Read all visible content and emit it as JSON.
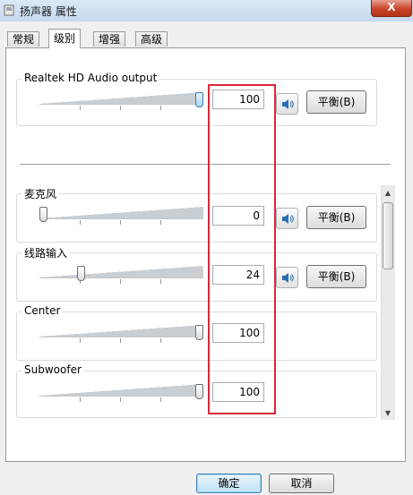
{
  "window": {
    "title": "扬声器 属性",
    "close_glyph": "X"
  },
  "tabs": [
    {
      "label": "常规"
    },
    {
      "label": "级别",
      "active": true
    },
    {
      "label": "增强"
    },
    {
      "label": "高级"
    }
  ],
  "master": {
    "label": "Realtek HD Audio output",
    "value": "100",
    "level_fraction": 1.0,
    "balance_label": "平衡(B)",
    "icon": "speaker-icon"
  },
  "channels": [
    {
      "label": "麦克风",
      "value": "0",
      "level_fraction": 0.0,
      "has_controls": true,
      "balance_label": "平衡(B)"
    },
    {
      "label": "线路输入",
      "value": "24",
      "level_fraction": 0.24,
      "has_controls": true,
      "balance_label": "平衡(B)"
    },
    {
      "label": "Center",
      "value": "100",
      "level_fraction": 1.0,
      "has_controls": false
    },
    {
      "label": "Subwoofer",
      "value": "100",
      "level_fraction": 1.0,
      "has_controls": false
    }
  ],
  "buttons": {
    "ok": "确定",
    "cancel": "取消"
  },
  "colors": {
    "highlight": "#d8283a",
    "accent": "#3c7fb1"
  }
}
